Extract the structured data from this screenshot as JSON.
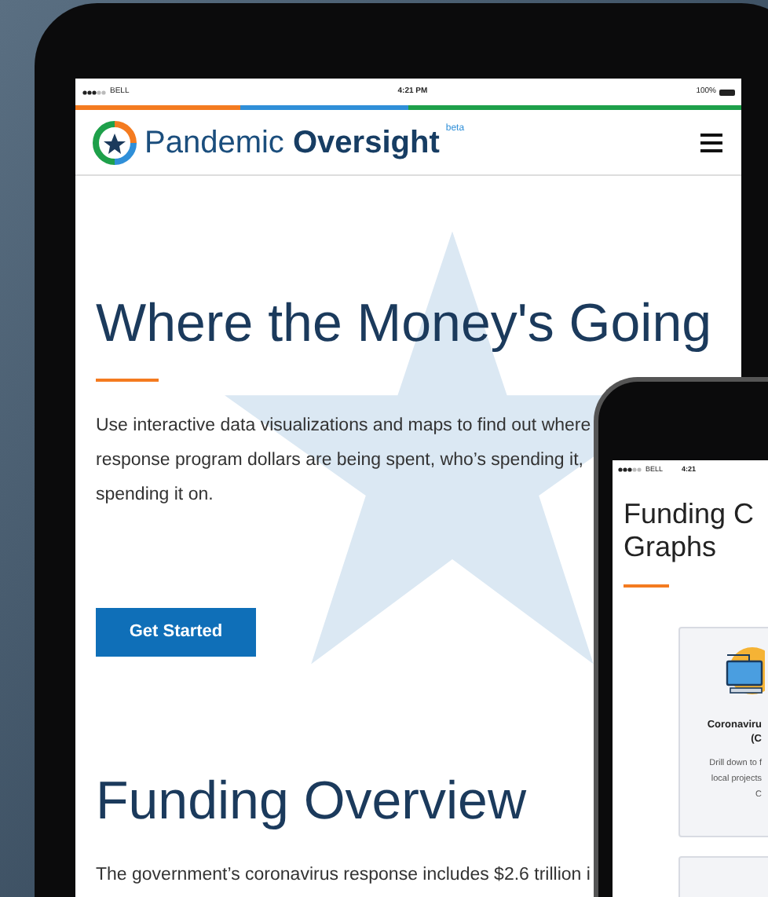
{
  "tablet": {
    "status_bar": {
      "carrier": "BELL",
      "time": "4:21 PM",
      "battery": "100%"
    },
    "header": {
      "brand_light": "Pandemic",
      "brand_bold": "Oversight",
      "badge": "beta"
    },
    "hero": {
      "title": "Where the Money's Going",
      "lines": [
        "Use interactive data visualizations and maps to find out where",
        "response program dollars are being spent, who’s spending it,",
        "spending it on."
      ],
      "button": "Get Started"
    },
    "section": {
      "title": "Funding Overview",
      "text": "The government’s coronavirus response includes $2.6 trillion i"
    }
  },
  "phone": {
    "status_bar": {
      "carrier": "BELL",
      "time": "4:21"
    },
    "title_lines": [
      "Funding C",
      "Graphs"
    ],
    "card": {
      "title_lines": [
        "Coronaviru",
        "(C"
      ],
      "text_lines": [
        "Drill down to f",
        "local projects",
        "C"
      ]
    }
  }
}
